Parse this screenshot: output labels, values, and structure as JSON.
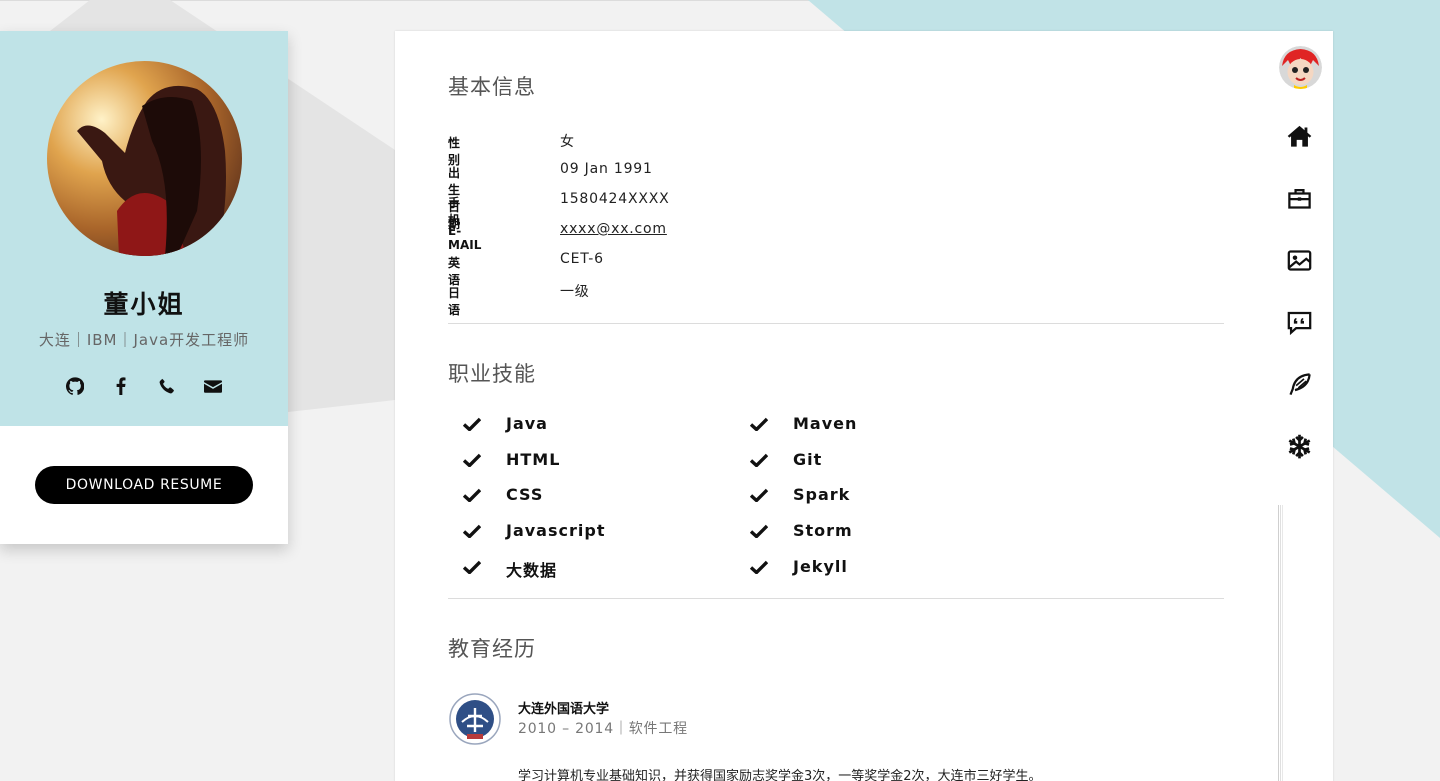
{
  "profile": {
    "name": "董小姐",
    "subtitle": "大连｜IBM｜Java开发工程师",
    "contact_icons": [
      "github-icon",
      "facebook-icon",
      "phone-icon",
      "envelope-icon"
    ],
    "download_label": "DOWNLOAD RESUME"
  },
  "basic": {
    "title": "基本信息",
    "rows": [
      {
        "key": "性别",
        "value": "女"
      },
      {
        "key": "出生日期",
        "value": "09 Jan 1991"
      },
      {
        "key": "手机",
        "value": "1580424XXXX"
      },
      {
        "key": "E-MAIL",
        "value": "xxxx@xx.com"
      },
      {
        "key": "英语",
        "value": "CET-6"
      },
      {
        "key": "日语",
        "value": "一级"
      }
    ]
  },
  "skills": {
    "title": "职业技能",
    "left": [
      "Java",
      "HTML",
      "CSS",
      "Javascript",
      "大数据"
    ],
    "right": [
      "Maven",
      "Git",
      "Spark",
      "Storm",
      "Jekyll"
    ]
  },
  "education": {
    "title": "教育经历",
    "school": "大连外国语大学",
    "meta": "2010 – 2014｜软件工程",
    "description": "学习计算机专业基础知识，并获得国家励志奖学金3次，一等奖学金2次，大连市三好学生。"
  },
  "nav": {
    "icons": [
      "home-icon",
      "briefcase-icon",
      "image-icon",
      "quote-icon",
      "feather-icon",
      "snowflake-icon"
    ]
  },
  "colors": {
    "accent": "#bfe3e7",
    "background": "#f2f2f2"
  }
}
